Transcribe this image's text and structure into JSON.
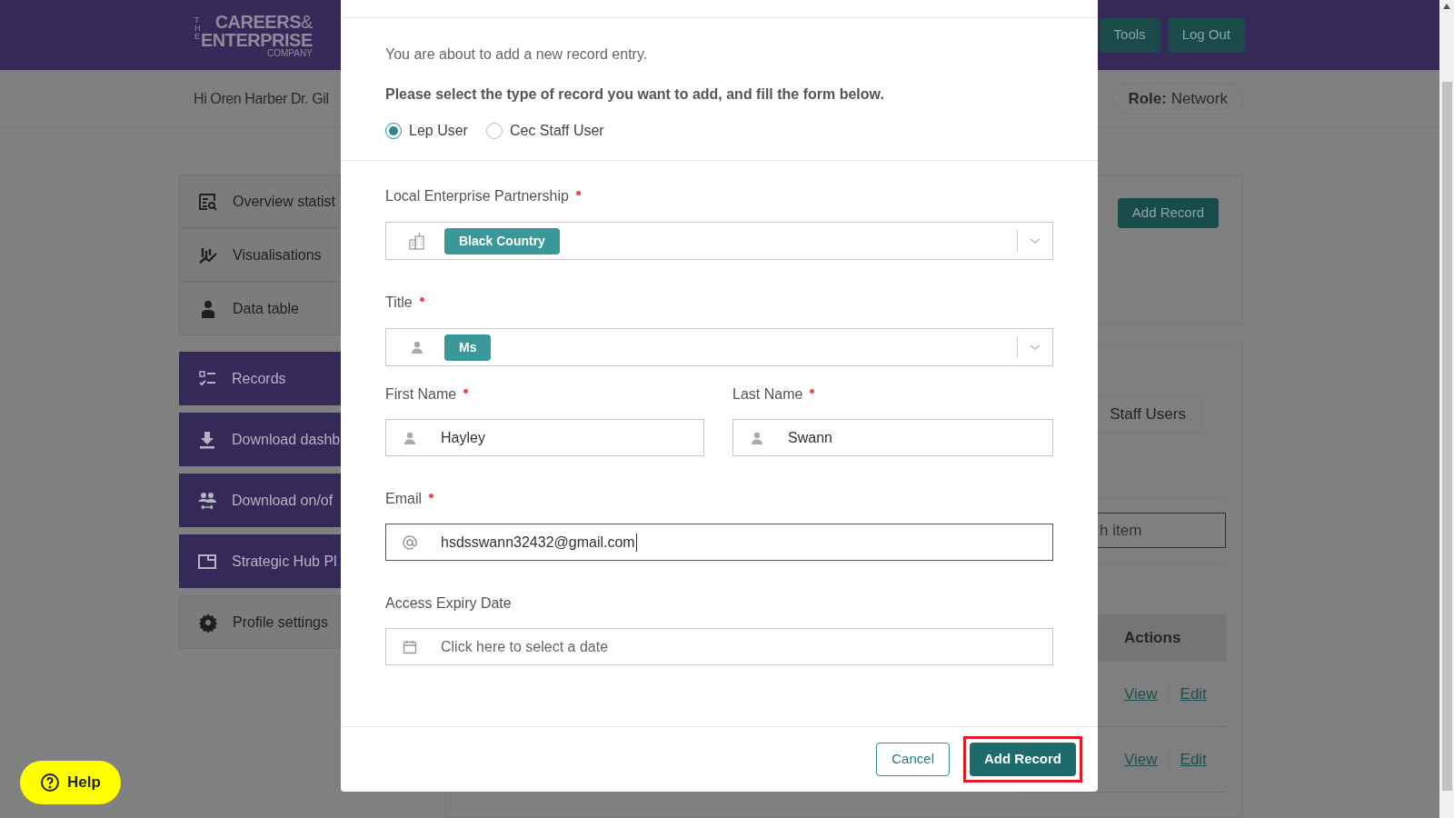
{
  "header": {
    "logo": {
      "prefix": "THE",
      "line1": "CAREERS",
      "amp": "&",
      "line2": "ENTERPRISE",
      "line3": "COMPANY"
    },
    "nav_buttons": [
      "Tools",
      "Log Out"
    ]
  },
  "greeting": "Hi Oren Harber Dr. Gil",
  "role": {
    "label": "Role:",
    "value": "Network"
  },
  "sidebar": {
    "items": [
      {
        "label": "Overview statist",
        "kind": "plain"
      },
      {
        "label": "Visualisations",
        "kind": "plain"
      },
      {
        "label": "Data table",
        "kind": "plain"
      },
      {
        "label": "Records",
        "kind": "accent"
      },
      {
        "label": "Download dashb",
        "kind": "accent"
      },
      {
        "label": "Download on/of",
        "kind": "accent"
      },
      {
        "label": "Strategic Hub Pl",
        "kind": "accent"
      },
      {
        "label": "Profile settings",
        "kind": "plain"
      }
    ]
  },
  "records_panel": {
    "add_button": "Add Record",
    "tab": "Staff Users",
    "search_placeholder": "h item",
    "table": {
      "columns": [
        "Actions"
      ],
      "rows": [
        {
          "actions": [
            "View",
            "Edit"
          ]
        },
        {
          "actions": [
            "View",
            "Edit"
          ]
        }
      ]
    }
  },
  "modal": {
    "intro": "You are about to add a new record entry.",
    "instruction": "Please select the type of record you want to add, and fill the form below.",
    "record_types": [
      {
        "label": "Lep User",
        "selected": true
      },
      {
        "label": "Cec Staff User",
        "selected": false
      }
    ],
    "fields": [
      {
        "kind": "select",
        "label": "Local Enterprise Partnership",
        "required": true,
        "chip": "Black Country"
      },
      {
        "kind": "select",
        "label": "Title",
        "required": true,
        "chip": "Ms"
      },
      {
        "kind": "text",
        "label": "First Name",
        "required": true,
        "value": "Hayley"
      },
      {
        "kind": "text",
        "label": "Last Name",
        "required": true,
        "value": "Swann"
      },
      {
        "kind": "email",
        "label": "Email",
        "required": true,
        "value": "hsdsswann32432@gmail.com",
        "focused": true
      },
      {
        "kind": "date",
        "label": "Access Expiry Date",
        "required": false,
        "placeholder": "Click here to select a date"
      }
    ],
    "buttons": [
      {
        "label": "Cancel",
        "kind": "secondary",
        "highlighted": false
      },
      {
        "label": "Add Record",
        "kind": "primary",
        "highlighted": true
      }
    ]
  },
  "help_button": "Help"
}
